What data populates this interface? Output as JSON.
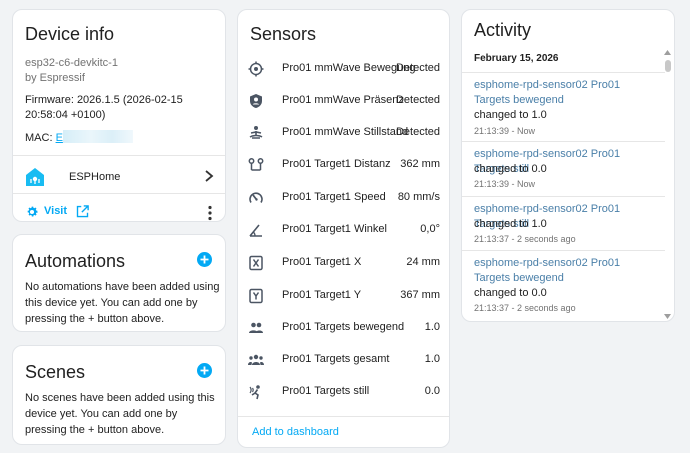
{
  "device": {
    "title": "Device info",
    "model": "esp32-c6-devkitc-1",
    "manufacturer": "by Espressif",
    "firmware": "Firmware: 2026.1.5 (2026-02-15 20:58:04 +0100)",
    "mac_label": "MAC:",
    "mac_value": "E",
    "integration": "ESPHome",
    "visit_label": "Visit"
  },
  "automations": {
    "title": "Automations",
    "empty_text": "No automations have been added using this device yet. You can add one by pressing the + button above."
  },
  "scenes": {
    "title": "Scenes",
    "empty_text": "No scenes have been added using this device yet. You can add one by pressing the + button above."
  },
  "sensors": {
    "title": "Sensors",
    "items": [
      {
        "name": "Pro01 mmWave Bewegung",
        "value": "Detected",
        "icon": "motion-crosshair-icon"
      },
      {
        "name": "Pro01 mmWave Präsenz",
        "value": "Detected",
        "icon": "shield-account-icon"
      },
      {
        "name": "Pro01 mmWave Stillstand",
        "value": "Detected",
        "icon": "meditation-icon"
      },
      {
        "name": "Pro01 Target1 Distanz",
        "value": "362 mm",
        "icon": "map-marker-distance-icon"
      },
      {
        "name": "Pro01 Target1 Speed",
        "value": "80 mm/s",
        "icon": "speedometer-icon"
      },
      {
        "name": "Pro01 Target1 Winkel",
        "value": "0,0°",
        "icon": "angle-acute-icon"
      },
      {
        "name": "Pro01 Target1 X",
        "value": "24 mm",
        "icon": "alpha-x-box-icon"
      },
      {
        "name": "Pro01 Target1 Y",
        "value": "367 mm",
        "icon": "alpha-y-box-icon"
      },
      {
        "name": "Pro01 Targets bewegend",
        "value": "1.0",
        "icon": "account-multiple-icon"
      },
      {
        "name": "Pro01 Targets gesamt",
        "value": "1.0",
        "icon": "account-group-icon"
      },
      {
        "name": "Pro01 Targets still",
        "value": "0.0",
        "icon": "human-wave-icon"
      }
    ],
    "add_dashboard": "Add to dashboard"
  },
  "activity": {
    "title": "Activity",
    "date": "February 15, 2026",
    "entries": [
      {
        "title": "esphome-rpd-sensor02 Pro01 Targets bewegend",
        "change": "changed to 1.0",
        "time": "21:13:39 - Now"
      },
      {
        "title": "esphome-rpd-sensor02 Pro01 Targets still",
        "change": "changed to 0.0",
        "time": "21:13:39 - Now"
      },
      {
        "title": "esphome-rpd-sensor02 Pro01 Targets still",
        "change": "changed to 1.0",
        "time": "21:13:37 - 2 seconds ago"
      },
      {
        "title": "esphome-rpd-sensor02 Pro01 Targets bewegend",
        "change": "changed to 0.0",
        "time": "21:13:37 - 2 seconds ago"
      }
    ]
  },
  "colors": {
    "accent": "#03a9f4",
    "icon": "#4b5563",
    "link_muted": "#4a7fa8",
    "background": "#f1f3f5"
  }
}
